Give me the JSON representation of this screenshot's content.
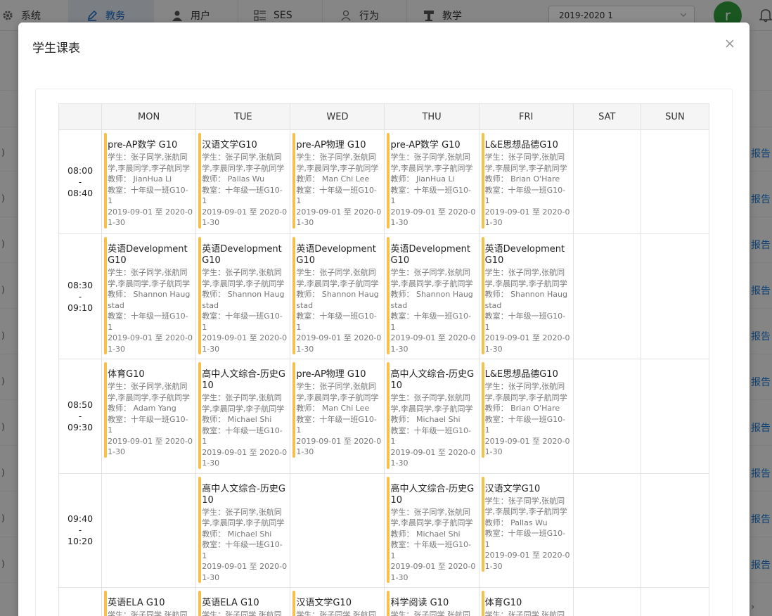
{
  "nav": {
    "items": [
      {
        "label": "系统",
        "icon": "gear-icon"
      },
      {
        "label": "教务",
        "icon": "pen-icon",
        "active": true
      },
      {
        "label": "用户",
        "icon": "user-icon"
      },
      {
        "label": "SES",
        "icon": "list-icon"
      },
      {
        "label": "行为",
        "icon": "person-icon"
      },
      {
        "label": "教学",
        "icon": "podium-icon"
      }
    ],
    "term_value": "2019-2020 1",
    "avatar_letter": "r"
  },
  "background": {
    "row_link_label": "报告",
    "row_marker": ")"
  },
  "modal": {
    "title": "学生课表",
    "accent_color": "#f5c04c"
  },
  "timetable": {
    "days": [
      "MON",
      "TUE",
      "WED",
      "THU",
      "FRI",
      "SAT",
      "SUN"
    ],
    "rows": [
      {
        "start": "08:00",
        "sep": "-",
        "end": "08:40",
        "cells": [
          {
            "name": "pre-AP数学 G10",
            "students": "学生：张子同学,张航同学,李晨同学,李子航同学",
            "teacher": "教师：  JianHua Li",
            "room": "教室：十年级一班G10-1",
            "dates": "2019-09-01 至 2020-01-30"
          },
          {
            "name": "汉语文学G10",
            "students": "学生：张子同学,张航同学,李晨同学,李子航同学",
            "teacher": "教师：  Pallas Wu",
            "room": "教室：十年级一班G10-1",
            "dates": "2019-09-01 至 2020-01-30"
          },
          {
            "name": "pre-AP物理 G10",
            "students": "学生：张子同学,张航同学,李晨同学,李子航同学",
            "teacher": "教师：  Man Chi Lee",
            "room": "教室：十年级一班G10-1",
            "dates": "2019-09-01 至 2020-01-30"
          },
          {
            "name": "pre-AP数学 G10",
            "students": "学生：张子同学,张航同学,李晨同学,李子航同学",
            "teacher": "教师：  JianHua Li",
            "room": "教室：十年级一班G10-1",
            "dates": "2019-09-01 至 2020-01-30"
          },
          {
            "name": "L&E思想品德G10",
            "students": "学生：张子同学,张航同学,李晨同学,李子航同学",
            "teacher": "教师：  Brian O'Hare",
            "room": "教室：十年级一班G10-1",
            "dates": "2019-09-01 至 2020-01-30"
          },
          null,
          null
        ]
      },
      {
        "start": "08:30",
        "sep": "-",
        "end": "09:10",
        "cells": [
          {
            "name": "英语Development G10",
            "students": "学生：张子同学,张航同学,李晨同学,李子航同学",
            "teacher": "教师：  Shannon Haugstad",
            "room": "教室：十年级一班G10-1",
            "dates": "2019-09-01 至 2020-01-30"
          },
          {
            "name": "英语Development G10",
            "students": "学生：张子同学,张航同学,李晨同学,李子航同学",
            "teacher": "教师：  Shannon Haugstad",
            "room": "教室：十年级一班G10-1",
            "dates": "2019-09-01 至 2020-01-30"
          },
          {
            "name": "英语Development G10",
            "students": "学生：张子同学,张航同学,李晨同学,李子航同学",
            "teacher": "教师：  Shannon Haugstad",
            "room": "教室：十年级一班G10-1",
            "dates": "2019-09-01 至 2020-01-30"
          },
          {
            "name": "英语Development G10",
            "students": "学生：张子同学,张航同学,李晨同学,李子航同学",
            "teacher": "教师：  Shannon Haugstad",
            "room": "教室：十年级一班G10-1",
            "dates": "2019-09-01 至 2020-01-30"
          },
          {
            "name": "英语Development G10",
            "students": "学生：张子同学,张航同学,李晨同学,李子航同学",
            "teacher": "教师：  Shannon Haugstad",
            "room": "教室：十年级一班G10-1",
            "dates": "2019-09-01 至 2020-01-30"
          },
          null,
          null
        ]
      },
      {
        "start": "08:50",
        "sep": "-",
        "end": "09:30",
        "cells": [
          {
            "name": "体育G10",
            "students": "学生：张子同学,张航同学,李晨同学,李子航同学",
            "teacher": "教师：  Adam Yang",
            "room": "教室：十年级一班G10-1",
            "dates": "2019-09-01 至 2020-01-30"
          },
          {
            "name": "高中人文综合-历史G10",
            "students": "学生：张子同学,张航同学,李晨同学,李子航同学",
            "teacher": "教师：  Michael Shi",
            "room": "教室：十年级一班G10-1",
            "dates": "2019-09-01 至 2020-01-30"
          },
          {
            "name": "pre-AP物理 G10",
            "students": "学生：张子同学,张航同学,李晨同学,李子航同学",
            "teacher": "教师：  Man Chi Lee",
            "room": "教室：十年级一班G10-1",
            "dates": "2019-09-01 至 2020-01-30"
          },
          {
            "name": "高中人文综合-历史G10",
            "students": "学生：张子同学,张航同学,李晨同学,李子航同学",
            "teacher": "教师：  Michael Shi",
            "room": "教室：十年级一班G10-1",
            "dates": "2019-09-01 至 2020-01-30"
          },
          {
            "name": "L&E思想品德G10",
            "students": "学生：张子同学,张航同学,李晨同学,李子航同学",
            "teacher": "教师：  Brian O'Hare",
            "room": "教室：十年级一班G10-1",
            "dates": "2019-09-01 至 2020-01-30"
          },
          null,
          null
        ]
      },
      {
        "start": "09:40",
        "sep": "-",
        "end": "10:20",
        "cells": [
          null,
          {
            "name": "高中人文综合-历史G10",
            "students": "学生：张子同学,张航同学,李晨同学,李子航同学",
            "teacher": "教师：  Michael Shi",
            "room": "教室：十年级一班G10-1",
            "dates": "2019-09-01 至 2020-01-30"
          },
          null,
          {
            "name": "高中人文综合-历史G10",
            "students": "学生：张子同学,张航同学,李晨同学,李子航同学",
            "teacher": "教师：  Michael Shi",
            "room": "教室：十年级一班G10-1",
            "dates": "2019-09-01 至 2020-01-30"
          },
          {
            "name": "汉语文学G10",
            "students": "学生：张子同学,张航同学,李晨同学,李子航同学",
            "teacher": "教师：  Pallas Wu",
            "room": "教室：十年级一班G10-1",
            "dates": "2019-09-01 至 2020-01-30"
          },
          null,
          null
        ]
      },
      {
        "start": "",
        "sep": "",
        "end": "",
        "cells": [
          {
            "name": "英语ELA G10",
            "students": "学生：张子同学,张航同学,李晨同学,李子航同学",
            "teacher": "",
            "room": "",
            "dates": ""
          },
          {
            "name": "英语ELA G10",
            "students": "学生：张子同学,张航同学,李晨同学,李子航同学",
            "teacher": "",
            "room": "",
            "dates": ""
          },
          {
            "name": "汉语文学G10",
            "students": "学生：张子同学,张航同学,李晨同学,李子航同学",
            "teacher": "",
            "room": "",
            "dates": ""
          },
          {
            "name": "科学阅读 G10",
            "students": "学生：张子同学,张航同学,李晨同学,李子航同学",
            "teacher": "",
            "room": "",
            "dates": ""
          },
          {
            "name": "体育G10",
            "students": "学生：张子同学,张航同学,李晨同学,李子航同学",
            "teacher": "",
            "room": "",
            "dates": ""
          },
          null,
          null
        ]
      }
    ]
  }
}
